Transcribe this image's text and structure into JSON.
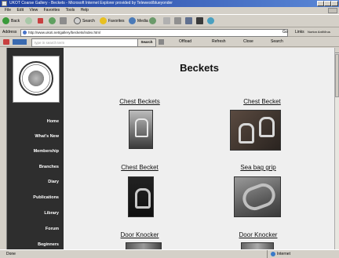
{
  "window": {
    "title": "UKOT Coarse Gallery - Beckets - Microsoft Internet Explorer provided by Telewest/blueyonder"
  },
  "menu": [
    "File",
    "Edit",
    "View",
    "Favorites",
    "Tools",
    "Help"
  ],
  "toolbar": {
    "back": "Back",
    "search": "Search",
    "favorites": "Favorites",
    "media": "Media"
  },
  "address": {
    "label": "Address",
    "url": "http://www.ukoti.net/gallery/beckets/index.html",
    "go": "Go",
    "links": "Links",
    "norton": "Norton AntiVirus"
  },
  "searchbar": {
    "placeholder": "type in search term",
    "search_button": "Search",
    "items": [
      "Offload",
      "Refresh",
      "Close",
      "Search"
    ]
  },
  "sidebar": {
    "nav": [
      "Home",
      "What's New",
      "Membership",
      "Branches",
      "Diary",
      "Publications",
      "Library",
      "Forum",
      "Beginners"
    ]
  },
  "page": {
    "title": "Beckets",
    "gallery": [
      {
        "label": "Chest Beckets"
      },
      {
        "label": "Chest Becket"
      },
      {
        "label": "Chest Becket"
      },
      {
        "label": "Sea bag grip"
      },
      {
        "label": "Door Knocker"
      },
      {
        "label": "Door Knocker"
      }
    ]
  },
  "status": {
    "text": "Done",
    "zone": "Internet"
  }
}
